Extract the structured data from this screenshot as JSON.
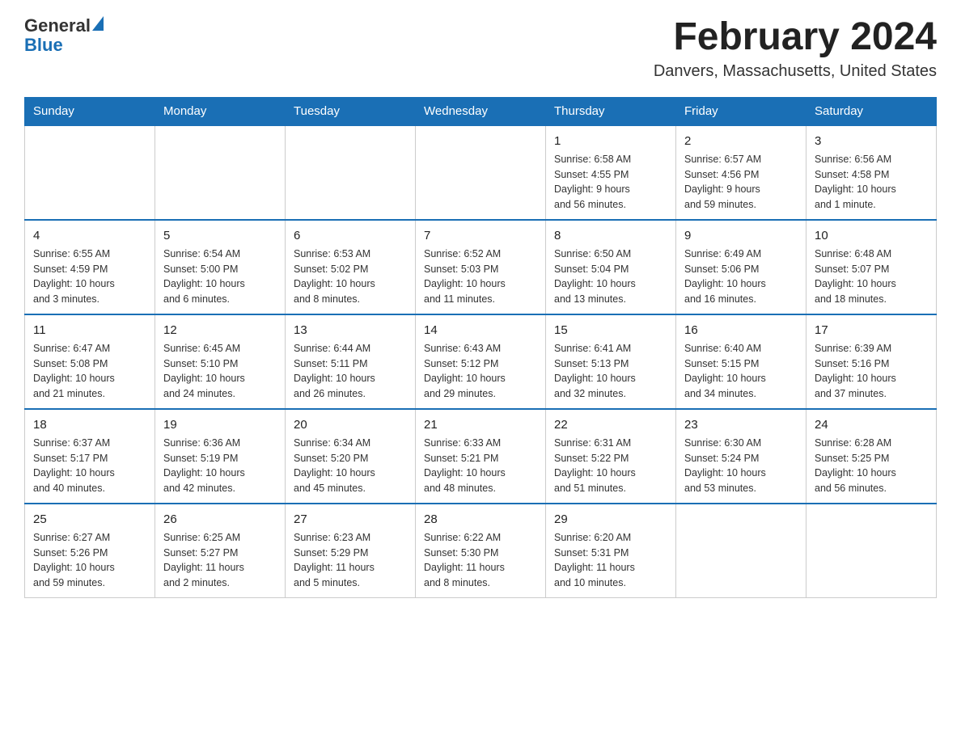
{
  "header": {
    "logo": {
      "general": "General",
      "blue": "Blue"
    },
    "title": "February 2024",
    "subtitle": "Danvers, Massachusetts, United States"
  },
  "weekdays": [
    "Sunday",
    "Monday",
    "Tuesday",
    "Wednesday",
    "Thursday",
    "Friday",
    "Saturday"
  ],
  "weeks": [
    {
      "days": [
        {
          "number": "",
          "info": ""
        },
        {
          "number": "",
          "info": ""
        },
        {
          "number": "",
          "info": ""
        },
        {
          "number": "",
          "info": ""
        },
        {
          "number": "1",
          "info": "Sunrise: 6:58 AM\nSunset: 4:55 PM\nDaylight: 9 hours\nand 56 minutes."
        },
        {
          "number": "2",
          "info": "Sunrise: 6:57 AM\nSunset: 4:56 PM\nDaylight: 9 hours\nand 59 minutes."
        },
        {
          "number": "3",
          "info": "Sunrise: 6:56 AM\nSunset: 4:58 PM\nDaylight: 10 hours\nand 1 minute."
        }
      ]
    },
    {
      "days": [
        {
          "number": "4",
          "info": "Sunrise: 6:55 AM\nSunset: 4:59 PM\nDaylight: 10 hours\nand 3 minutes."
        },
        {
          "number": "5",
          "info": "Sunrise: 6:54 AM\nSunset: 5:00 PM\nDaylight: 10 hours\nand 6 minutes."
        },
        {
          "number": "6",
          "info": "Sunrise: 6:53 AM\nSunset: 5:02 PM\nDaylight: 10 hours\nand 8 minutes."
        },
        {
          "number": "7",
          "info": "Sunrise: 6:52 AM\nSunset: 5:03 PM\nDaylight: 10 hours\nand 11 minutes."
        },
        {
          "number": "8",
          "info": "Sunrise: 6:50 AM\nSunset: 5:04 PM\nDaylight: 10 hours\nand 13 minutes."
        },
        {
          "number": "9",
          "info": "Sunrise: 6:49 AM\nSunset: 5:06 PM\nDaylight: 10 hours\nand 16 minutes."
        },
        {
          "number": "10",
          "info": "Sunrise: 6:48 AM\nSunset: 5:07 PM\nDaylight: 10 hours\nand 18 minutes."
        }
      ]
    },
    {
      "days": [
        {
          "number": "11",
          "info": "Sunrise: 6:47 AM\nSunset: 5:08 PM\nDaylight: 10 hours\nand 21 minutes."
        },
        {
          "number": "12",
          "info": "Sunrise: 6:45 AM\nSunset: 5:10 PM\nDaylight: 10 hours\nand 24 minutes."
        },
        {
          "number": "13",
          "info": "Sunrise: 6:44 AM\nSunset: 5:11 PM\nDaylight: 10 hours\nand 26 minutes."
        },
        {
          "number": "14",
          "info": "Sunrise: 6:43 AM\nSunset: 5:12 PM\nDaylight: 10 hours\nand 29 minutes."
        },
        {
          "number": "15",
          "info": "Sunrise: 6:41 AM\nSunset: 5:13 PM\nDaylight: 10 hours\nand 32 minutes."
        },
        {
          "number": "16",
          "info": "Sunrise: 6:40 AM\nSunset: 5:15 PM\nDaylight: 10 hours\nand 34 minutes."
        },
        {
          "number": "17",
          "info": "Sunrise: 6:39 AM\nSunset: 5:16 PM\nDaylight: 10 hours\nand 37 minutes."
        }
      ]
    },
    {
      "days": [
        {
          "number": "18",
          "info": "Sunrise: 6:37 AM\nSunset: 5:17 PM\nDaylight: 10 hours\nand 40 minutes."
        },
        {
          "number": "19",
          "info": "Sunrise: 6:36 AM\nSunset: 5:19 PM\nDaylight: 10 hours\nand 42 minutes."
        },
        {
          "number": "20",
          "info": "Sunrise: 6:34 AM\nSunset: 5:20 PM\nDaylight: 10 hours\nand 45 minutes."
        },
        {
          "number": "21",
          "info": "Sunrise: 6:33 AM\nSunset: 5:21 PM\nDaylight: 10 hours\nand 48 minutes."
        },
        {
          "number": "22",
          "info": "Sunrise: 6:31 AM\nSunset: 5:22 PM\nDaylight: 10 hours\nand 51 minutes."
        },
        {
          "number": "23",
          "info": "Sunrise: 6:30 AM\nSunset: 5:24 PM\nDaylight: 10 hours\nand 53 minutes."
        },
        {
          "number": "24",
          "info": "Sunrise: 6:28 AM\nSunset: 5:25 PM\nDaylight: 10 hours\nand 56 minutes."
        }
      ]
    },
    {
      "days": [
        {
          "number": "25",
          "info": "Sunrise: 6:27 AM\nSunset: 5:26 PM\nDaylight: 10 hours\nand 59 minutes."
        },
        {
          "number": "26",
          "info": "Sunrise: 6:25 AM\nSunset: 5:27 PM\nDaylight: 11 hours\nand 2 minutes."
        },
        {
          "number": "27",
          "info": "Sunrise: 6:23 AM\nSunset: 5:29 PM\nDaylight: 11 hours\nand 5 minutes."
        },
        {
          "number": "28",
          "info": "Sunrise: 6:22 AM\nSunset: 5:30 PM\nDaylight: 11 hours\nand 8 minutes."
        },
        {
          "number": "29",
          "info": "Sunrise: 6:20 AM\nSunset: 5:31 PM\nDaylight: 11 hours\nand 10 minutes."
        },
        {
          "number": "",
          "info": ""
        },
        {
          "number": "",
          "info": ""
        }
      ]
    }
  ]
}
